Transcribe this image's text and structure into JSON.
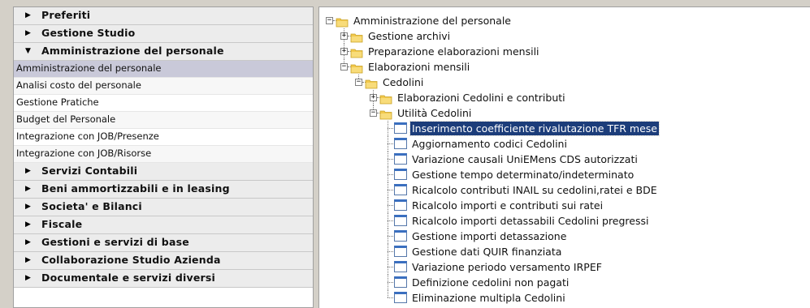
{
  "sidebar": {
    "sections_top": [
      {
        "label": "Preferiti",
        "expanded": false
      },
      {
        "label": "Gestione Studio",
        "expanded": false
      },
      {
        "label": "Amministrazione del personale",
        "expanded": true
      }
    ],
    "subitems": [
      {
        "label": "Amministrazione del personale",
        "selected": true
      },
      {
        "label": "Analisi costo del personale"
      },
      {
        "label": "Gestione Pratiche"
      },
      {
        "label": "Budget del Personale"
      },
      {
        "label": "Integrazione con JOB/Presenze"
      },
      {
        "label": "Integrazione con JOB/Risorse"
      }
    ],
    "sections_bottom": [
      {
        "label": "Servizi Contabili"
      },
      {
        "label": "Beni ammortizzabili e in leasing"
      },
      {
        "label": "Societa' e Bilanci"
      },
      {
        "label": "Fiscale"
      },
      {
        "label": "Gestioni e servizi di base"
      },
      {
        "label": "Collaborazione Studio Azienda"
      },
      {
        "label": "Documentale e servizi diversi"
      }
    ],
    "expanded_arrow_icon": "triangle-down-icon",
    "collapsed_arrow_icon": "triangle-right-icon"
  },
  "tree": {
    "nodes": [
      {
        "label": "Amministrazione del personale",
        "level": 0,
        "type": "folder",
        "expander": "minus"
      },
      {
        "label": "Gestione archivi",
        "level": 1,
        "type": "folder",
        "expander": "plus"
      },
      {
        "label": "Preparazione elaborazioni mensili",
        "level": 1,
        "type": "folder",
        "expander": "plus"
      },
      {
        "label": "Elaborazioni mensili",
        "level": 1,
        "type": "folder",
        "expander": "minus"
      },
      {
        "label": "Cedolini",
        "level": 2,
        "type": "folder",
        "expander": "minus"
      },
      {
        "label": "Elaborazioni Cedolini e contributi",
        "level": 3,
        "type": "folder",
        "expander": "plus"
      },
      {
        "label": "Utilità Cedolini",
        "level": 3,
        "type": "folder",
        "expander": "minus"
      },
      {
        "label": "Inserimento coefficiente rivalutazione TFR mese",
        "level": 4,
        "type": "item",
        "selected": true
      },
      {
        "label": "Aggiornamento codici Cedolini",
        "level": 4,
        "type": "item"
      },
      {
        "label": "Variazione causali UniEMens CDS autorizzati",
        "level": 4,
        "type": "item"
      },
      {
        "label": "Gestione tempo determinato/indeterminato",
        "level": 4,
        "type": "item"
      },
      {
        "label": "Ricalcolo contributi INAIL su cedolini,ratei e BDE",
        "level": 4,
        "type": "item"
      },
      {
        "label": "Ricalcolo importi e contributi sui ratei",
        "level": 4,
        "type": "item"
      },
      {
        "label": "Ricalcolo importi detassabili Cedolini pregressi",
        "level": 4,
        "type": "item"
      },
      {
        "label": "Gestione importi detassazione",
        "level": 4,
        "type": "item"
      },
      {
        "label": "Gestione dati QUIR finanziata",
        "level": 4,
        "type": "item"
      },
      {
        "label": "Variazione periodo versamento IRPEF",
        "level": 4,
        "type": "item"
      },
      {
        "label": "Definizione cedolini non pagati",
        "level": 4,
        "type": "item"
      },
      {
        "label": "Eliminazione multipla Cedolini",
        "level": 4,
        "type": "item"
      }
    ],
    "folder_icon": "folder-icon",
    "item_icon": "window-item-icon",
    "colors": {
      "selection": "#1c3d7a",
      "folder": "#f2c94c"
    }
  }
}
